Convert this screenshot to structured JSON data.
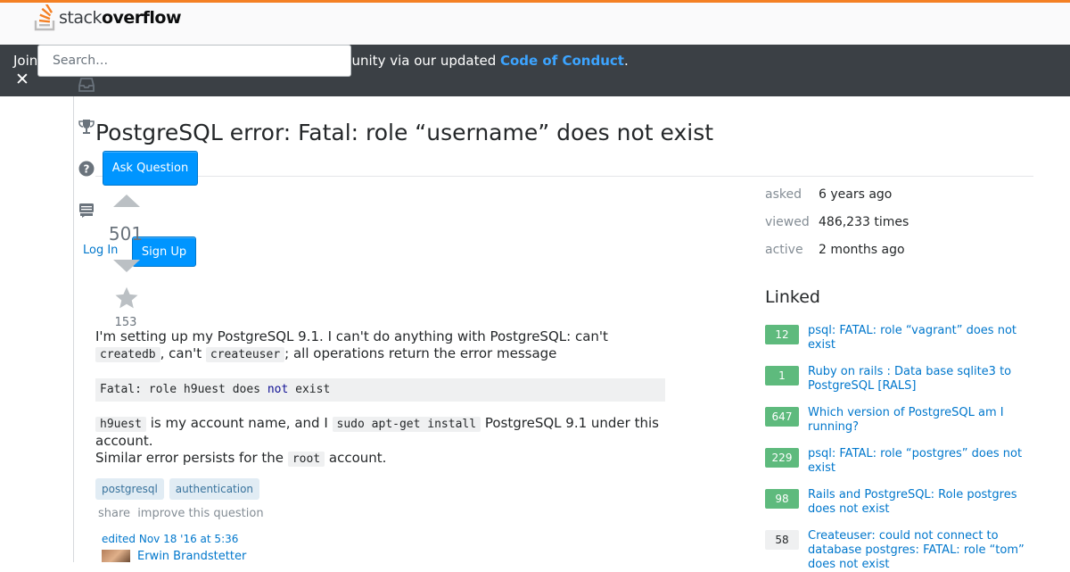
{
  "header": {
    "logo_light": "stack",
    "logo_bold": "overflow",
    "brand_color": "#f48024"
  },
  "search": {
    "placeholder": "Search…"
  },
  "banner": {
    "text_start": "Join",
    "text_visible": "mmunity via our updated ",
    "link_text": "Code of Conduct",
    "link_suffix": ".",
    "close_label": "✕"
  },
  "sidebar": {
    "icons": [
      "inbox-icon",
      "trophy-icon",
      "help-icon",
      "chat-icon"
    ]
  },
  "actions": {
    "ask_question": "Ask Question",
    "log_in": "Log In",
    "sign_up": "Sign Up"
  },
  "question": {
    "title": "PostgreSQL error: Fatal: role “username” does not exist",
    "votes": "501",
    "favorites": "153",
    "body": {
      "p1_a": "I'm setting up my PostgreSQL 9.1. I can't do anything with PostgreSQL: can't ",
      "p1_code1": "createdb",
      "p1_b": ", can't ",
      "p1_code2": "createuser",
      "p1_c": "; all operations return the error message",
      "code_a": "Fatal: role h9uest does ",
      "code_kw": "not",
      "code_b": " exist",
      "p2_code1": "h9uest",
      "p2_a": " is my account name, and I ",
      "p2_code2": "sudo apt-get install",
      "p2_b": " PostgreSQL 9.1 under this account.",
      "p3_a": "Similar error persists for the ",
      "p3_code": "root",
      "p3_b": " account."
    },
    "tags": [
      "postgresql",
      "authentication"
    ],
    "menu": {
      "share": "share",
      "improve": "improve this question"
    },
    "edited": "edited Nov 18 '16 at 5:36",
    "editor": "Erwin Brandstetter"
  },
  "stats": [
    {
      "label": "asked",
      "value": "6 years ago"
    },
    {
      "label": "viewed",
      "value": "486,233 times"
    },
    {
      "label": "active",
      "value": "2 months ago"
    }
  ],
  "linked": {
    "title": "Linked",
    "items": [
      {
        "score": "12",
        "answered": true,
        "title": "psql: FATAL: role “vagrant” does not exist"
      },
      {
        "score": "1",
        "answered": true,
        "title": "Ruby on rails : Data base sqlite3 to PostgreSQL [RALS]"
      },
      {
        "score": "647",
        "answered": true,
        "title": "Which version of PostgreSQL am I running?"
      },
      {
        "score": "229",
        "answered": true,
        "title": "psql: FATAL: role “postgres” does not exist"
      },
      {
        "score": "98",
        "answered": true,
        "title": "Rails and PostgreSQL: Role postgres does not exist"
      },
      {
        "score": "58",
        "answered": false,
        "title": "Createuser: could not connect to database postgres: FATAL: role “tom” does not exist"
      }
    ]
  }
}
